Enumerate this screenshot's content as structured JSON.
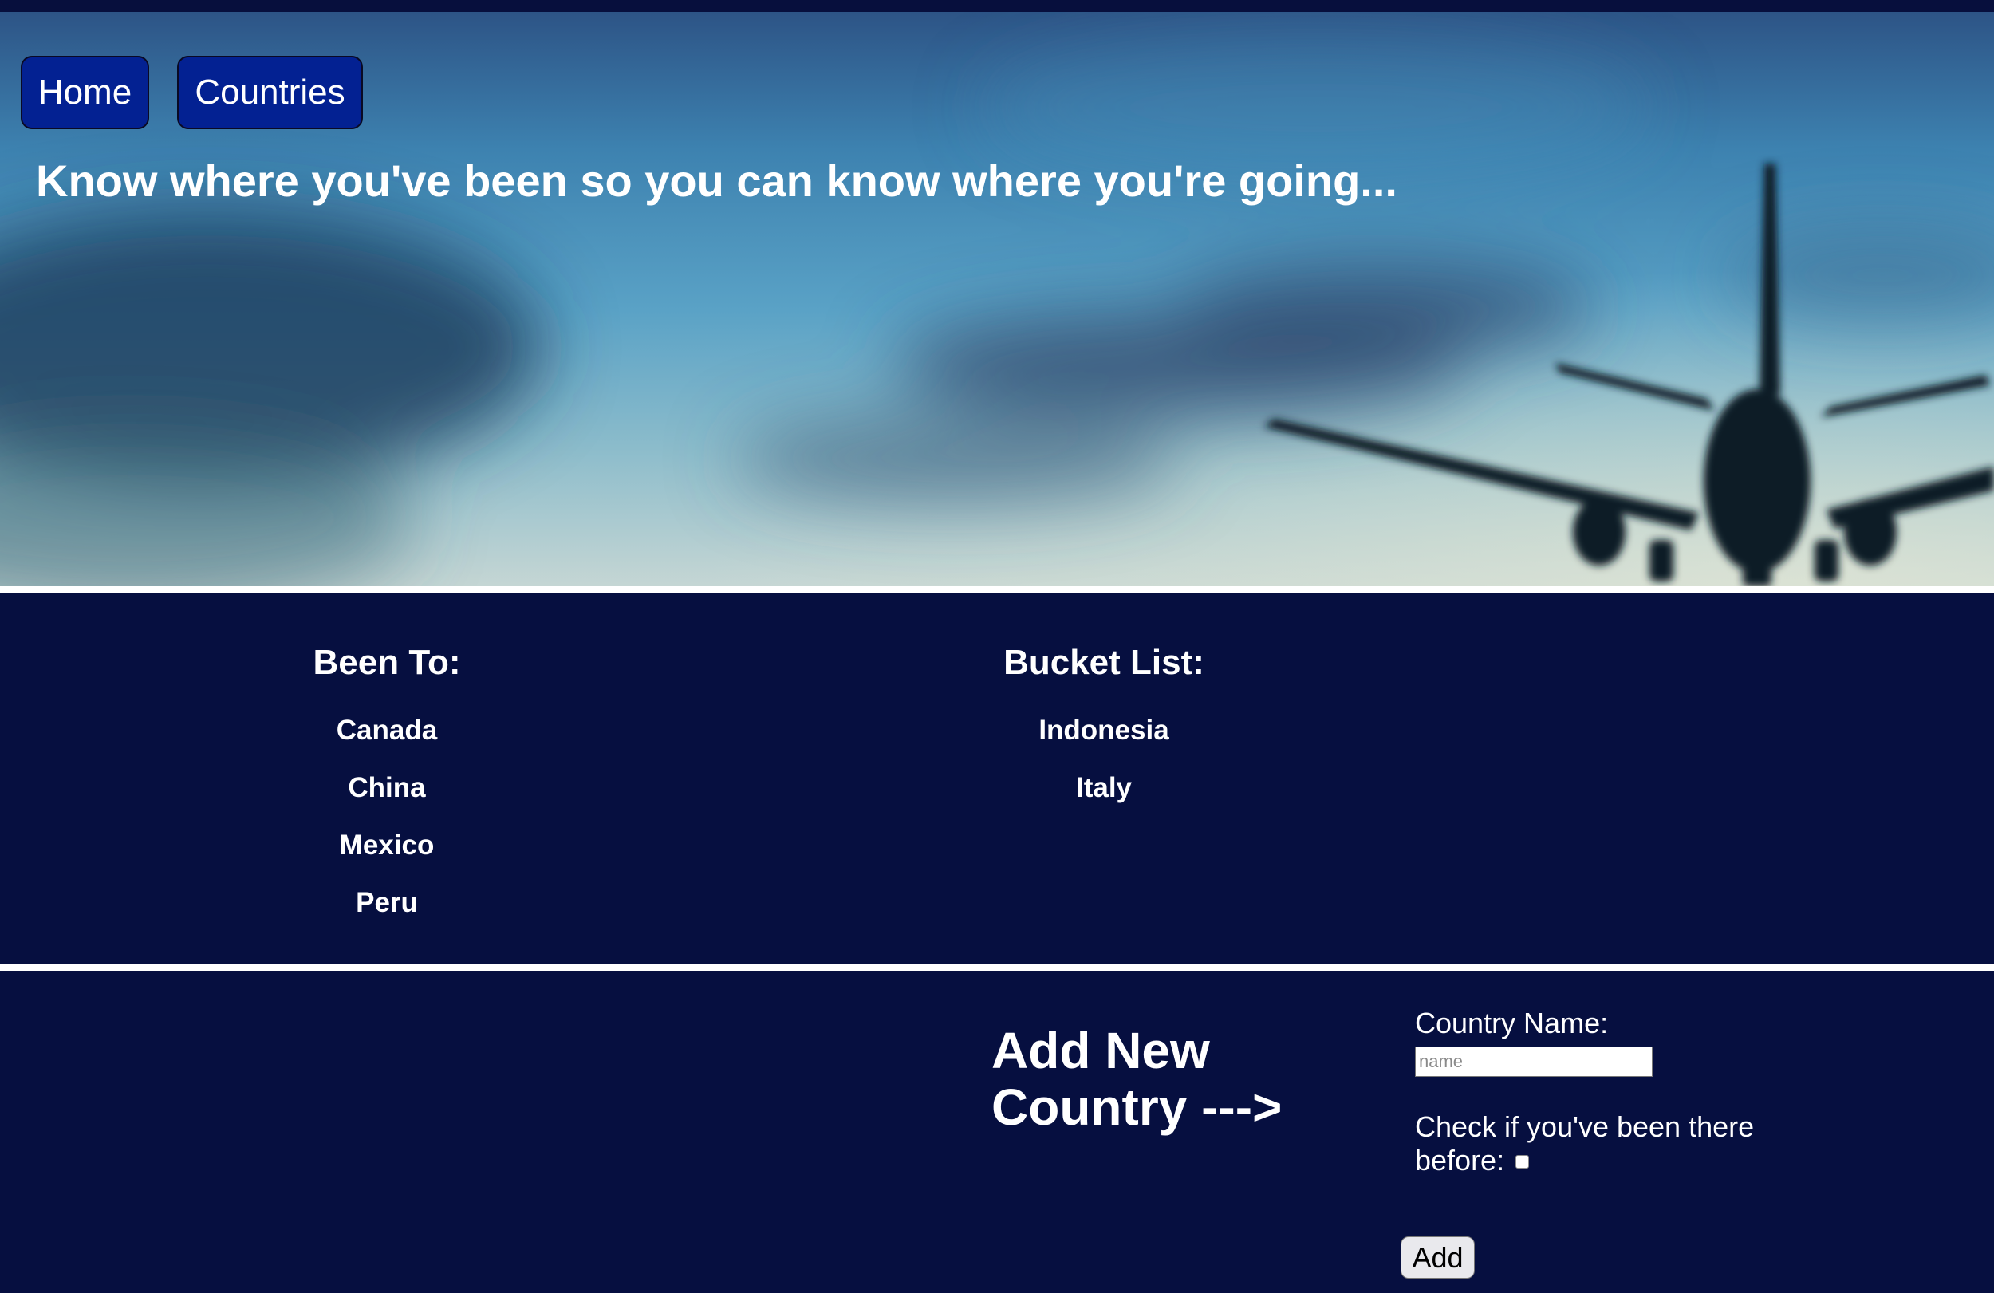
{
  "nav": {
    "home_label": "Home",
    "countries_label": "Countries"
  },
  "hero": {
    "tagline": "Know where you've been so you can know where you're going..."
  },
  "lists": {
    "been_to": {
      "heading": "Been To:",
      "countries": [
        "Canada",
        "China",
        "Mexico",
        "Peru"
      ]
    },
    "bucket_list": {
      "heading": "Bucket List:",
      "countries": [
        "Indonesia",
        "Italy"
      ]
    }
  },
  "add_form": {
    "title_line1": "Add New",
    "title_line2": "Country --->",
    "name_label": "Country Name:",
    "name_placeholder": "name",
    "name_value": "",
    "visited_label": "Check if you've been there before:",
    "visited_checked": false,
    "add_label": "Add"
  },
  "colors": {
    "background": "#060f40",
    "nav_button": "#032192",
    "divider": "#ffffff"
  }
}
